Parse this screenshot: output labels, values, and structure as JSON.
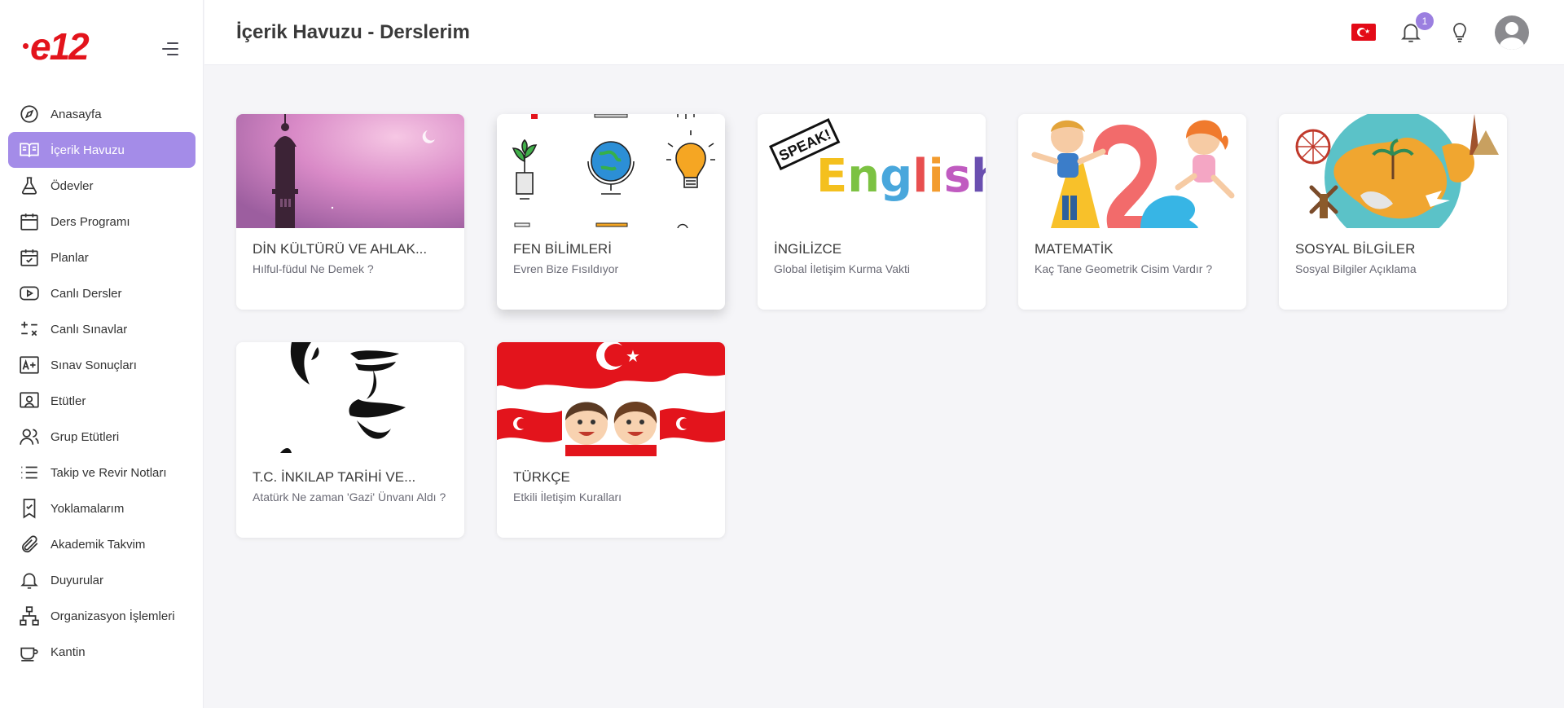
{
  "logo": {
    "text": "e12"
  },
  "header": {
    "title": "İçerik Havuzu - Derslerim",
    "notification_count": "1"
  },
  "sidebar": {
    "items": [
      {
        "label": "Anasayfa",
        "icon": "compass-icon"
      },
      {
        "label": "İçerik Havuzu",
        "icon": "open-book-icon",
        "active": true
      },
      {
        "label": "Ödevler",
        "icon": "flask-icon"
      },
      {
        "label": "Ders Programı",
        "icon": "calendar-icon"
      },
      {
        "label": "Planlar",
        "icon": "calendar-check-icon"
      },
      {
        "label": "Canlı Dersler",
        "icon": "play-icon"
      },
      {
        "label": "Canlı Sınavlar",
        "icon": "math-operators-icon"
      },
      {
        "label": "Sınav Sonuçları",
        "icon": "grade-icon"
      },
      {
        "label": "Etütler",
        "icon": "board-icon"
      },
      {
        "label": "Grup Etütleri",
        "icon": "users-icon"
      },
      {
        "label": "Takip ve Revir Notları",
        "icon": "list-icon"
      },
      {
        "label": "Yoklamalarım",
        "icon": "bookmark-check-icon"
      },
      {
        "label": "Akademik Takvim",
        "icon": "paperclip-icon"
      },
      {
        "label": "Duyurular",
        "icon": "bell-icon"
      },
      {
        "label": "Organizasyon İşlemleri",
        "icon": "org-chart-icon"
      },
      {
        "label": "Kantin",
        "icon": "cup-icon"
      }
    ]
  },
  "courses": [
    {
      "title": "DİN KÜLTÜRÜ VE AHLAK...",
      "subtitle": "Hılful-füdul Ne Demek ?"
    },
    {
      "title": "FEN BİLİMLERİ",
      "subtitle": "Evren Bize Fısıldıyor"
    },
    {
      "title": "İNGİLİZCE",
      "subtitle": "Global İletişim Kurma Vakti",
      "thumb_text": "English",
      "thumb_badge": "SPEAK!"
    },
    {
      "title": "MATEMATİK",
      "subtitle": "Kaç Tane Geometrik Cisim Vardır ?"
    },
    {
      "title": "SOSYAL BİLGİLER",
      "subtitle": "Sosyal Bilgiler Açıklama"
    },
    {
      "title": "T.C. İNKILAP TARİHİ VE...",
      "subtitle": "Atatürk Ne zaman 'Gazi' Ünvanı Aldı ?"
    },
    {
      "title": "TÜRKÇE",
      "subtitle": "Etkili İletişim Kuralları"
    }
  ],
  "colors": {
    "accent": "#a48ce8",
    "logo_red": "#e3141c",
    "badge": "#9b7fe0"
  }
}
